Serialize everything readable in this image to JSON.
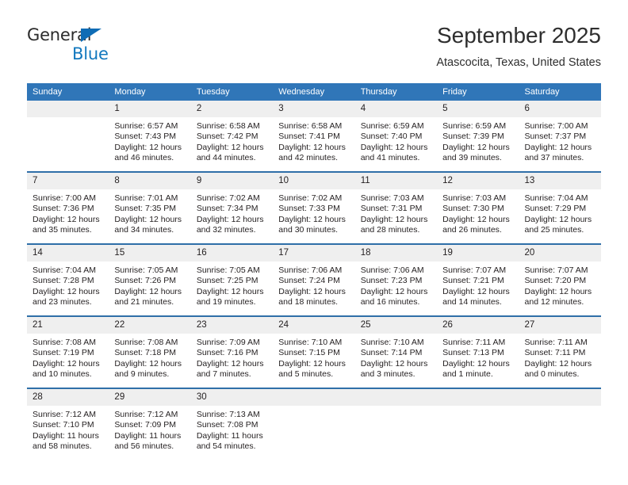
{
  "brand": {
    "line1": "General",
    "line2": "Blue",
    "triangle_color": "#0f6cb5",
    "text_color": "#2b2b2b",
    "blue_color": "#1278be"
  },
  "header": {
    "title": "September 2025",
    "subtitle": "Atascocita, Texas, United States"
  },
  "theme": {
    "header_bg": "#3076b8",
    "row_divider": "#2f6fa8",
    "daynum_bg": "#efefef",
    "text": "#231f20"
  },
  "calendar": {
    "weekday_headers": [
      "Sunday",
      "Monday",
      "Tuesday",
      "Wednesday",
      "Thursday",
      "Friday",
      "Saturday"
    ],
    "weeks": [
      [
        {
          "day": "",
          "empty": true,
          "sunrise": "",
          "sunset": "",
          "daylight1": "",
          "daylight2": ""
        },
        {
          "day": "1",
          "sunrise": "Sunrise: 6:57 AM",
          "sunset": "Sunset: 7:43 PM",
          "daylight1": "Daylight: 12 hours",
          "daylight2": "and 46 minutes."
        },
        {
          "day": "2",
          "sunrise": "Sunrise: 6:58 AM",
          "sunset": "Sunset: 7:42 PM",
          "daylight1": "Daylight: 12 hours",
          "daylight2": "and 44 minutes."
        },
        {
          "day": "3",
          "sunrise": "Sunrise: 6:58 AM",
          "sunset": "Sunset: 7:41 PM",
          "daylight1": "Daylight: 12 hours",
          "daylight2": "and 42 minutes."
        },
        {
          "day": "4",
          "sunrise": "Sunrise: 6:59 AM",
          "sunset": "Sunset: 7:40 PM",
          "daylight1": "Daylight: 12 hours",
          "daylight2": "and 41 minutes."
        },
        {
          "day": "5",
          "sunrise": "Sunrise: 6:59 AM",
          "sunset": "Sunset: 7:39 PM",
          "daylight1": "Daylight: 12 hours",
          "daylight2": "and 39 minutes."
        },
        {
          "day": "6",
          "sunrise": "Sunrise: 7:00 AM",
          "sunset": "Sunset: 7:37 PM",
          "daylight1": "Daylight: 12 hours",
          "daylight2": "and 37 minutes."
        }
      ],
      [
        {
          "day": "7",
          "sunrise": "Sunrise: 7:00 AM",
          "sunset": "Sunset: 7:36 PM",
          "daylight1": "Daylight: 12 hours",
          "daylight2": "and 35 minutes."
        },
        {
          "day": "8",
          "sunrise": "Sunrise: 7:01 AM",
          "sunset": "Sunset: 7:35 PM",
          "daylight1": "Daylight: 12 hours",
          "daylight2": "and 34 minutes."
        },
        {
          "day": "9",
          "sunrise": "Sunrise: 7:02 AM",
          "sunset": "Sunset: 7:34 PM",
          "daylight1": "Daylight: 12 hours",
          "daylight2": "and 32 minutes."
        },
        {
          "day": "10",
          "sunrise": "Sunrise: 7:02 AM",
          "sunset": "Sunset: 7:33 PM",
          "daylight1": "Daylight: 12 hours",
          "daylight2": "and 30 minutes."
        },
        {
          "day": "11",
          "sunrise": "Sunrise: 7:03 AM",
          "sunset": "Sunset: 7:31 PM",
          "daylight1": "Daylight: 12 hours",
          "daylight2": "and 28 minutes."
        },
        {
          "day": "12",
          "sunrise": "Sunrise: 7:03 AM",
          "sunset": "Sunset: 7:30 PM",
          "daylight1": "Daylight: 12 hours",
          "daylight2": "and 26 minutes."
        },
        {
          "day": "13",
          "sunrise": "Sunrise: 7:04 AM",
          "sunset": "Sunset: 7:29 PM",
          "daylight1": "Daylight: 12 hours",
          "daylight2": "and 25 minutes."
        }
      ],
      [
        {
          "day": "14",
          "sunrise": "Sunrise: 7:04 AM",
          "sunset": "Sunset: 7:28 PM",
          "daylight1": "Daylight: 12 hours",
          "daylight2": "and 23 minutes."
        },
        {
          "day": "15",
          "sunrise": "Sunrise: 7:05 AM",
          "sunset": "Sunset: 7:26 PM",
          "daylight1": "Daylight: 12 hours",
          "daylight2": "and 21 minutes."
        },
        {
          "day": "16",
          "sunrise": "Sunrise: 7:05 AM",
          "sunset": "Sunset: 7:25 PM",
          "daylight1": "Daylight: 12 hours",
          "daylight2": "and 19 minutes."
        },
        {
          "day": "17",
          "sunrise": "Sunrise: 7:06 AM",
          "sunset": "Sunset: 7:24 PM",
          "daylight1": "Daylight: 12 hours",
          "daylight2": "and 18 minutes."
        },
        {
          "day": "18",
          "sunrise": "Sunrise: 7:06 AM",
          "sunset": "Sunset: 7:23 PM",
          "daylight1": "Daylight: 12 hours",
          "daylight2": "and 16 minutes."
        },
        {
          "day": "19",
          "sunrise": "Sunrise: 7:07 AM",
          "sunset": "Sunset: 7:21 PM",
          "daylight1": "Daylight: 12 hours",
          "daylight2": "and 14 minutes."
        },
        {
          "day": "20",
          "sunrise": "Sunrise: 7:07 AM",
          "sunset": "Sunset: 7:20 PM",
          "daylight1": "Daylight: 12 hours",
          "daylight2": "and 12 minutes."
        }
      ],
      [
        {
          "day": "21",
          "sunrise": "Sunrise: 7:08 AM",
          "sunset": "Sunset: 7:19 PM",
          "daylight1": "Daylight: 12 hours",
          "daylight2": "and 10 minutes."
        },
        {
          "day": "22",
          "sunrise": "Sunrise: 7:08 AM",
          "sunset": "Sunset: 7:18 PM",
          "daylight1": "Daylight: 12 hours",
          "daylight2": "and 9 minutes."
        },
        {
          "day": "23",
          "sunrise": "Sunrise: 7:09 AM",
          "sunset": "Sunset: 7:16 PM",
          "daylight1": "Daylight: 12 hours",
          "daylight2": "and 7 minutes."
        },
        {
          "day": "24",
          "sunrise": "Sunrise: 7:10 AM",
          "sunset": "Sunset: 7:15 PM",
          "daylight1": "Daylight: 12 hours",
          "daylight2": "and 5 minutes."
        },
        {
          "day": "25",
          "sunrise": "Sunrise: 7:10 AM",
          "sunset": "Sunset: 7:14 PM",
          "daylight1": "Daylight: 12 hours",
          "daylight2": "and 3 minutes."
        },
        {
          "day": "26",
          "sunrise": "Sunrise: 7:11 AM",
          "sunset": "Sunset: 7:13 PM",
          "daylight1": "Daylight: 12 hours",
          "daylight2": "and 1 minute."
        },
        {
          "day": "27",
          "sunrise": "Sunrise: 7:11 AM",
          "sunset": "Sunset: 7:11 PM",
          "daylight1": "Daylight: 12 hours",
          "daylight2": "and 0 minutes."
        }
      ],
      [
        {
          "day": "28",
          "sunrise": "Sunrise: 7:12 AM",
          "sunset": "Sunset: 7:10 PM",
          "daylight1": "Daylight: 11 hours",
          "daylight2": "and 58 minutes."
        },
        {
          "day": "29",
          "sunrise": "Sunrise: 7:12 AM",
          "sunset": "Sunset: 7:09 PM",
          "daylight1": "Daylight: 11 hours",
          "daylight2": "and 56 minutes."
        },
        {
          "day": "30",
          "sunrise": "Sunrise: 7:13 AM",
          "sunset": "Sunset: 7:08 PM",
          "daylight1": "Daylight: 11 hours",
          "daylight2": "and 54 minutes."
        },
        {
          "day": "",
          "empty": true,
          "sunrise": "",
          "sunset": "",
          "daylight1": "",
          "daylight2": ""
        },
        {
          "day": "",
          "empty": true,
          "sunrise": "",
          "sunset": "",
          "daylight1": "",
          "daylight2": ""
        },
        {
          "day": "",
          "empty": true,
          "sunrise": "",
          "sunset": "",
          "daylight1": "",
          "daylight2": ""
        },
        {
          "day": "",
          "empty": true,
          "sunrise": "",
          "sunset": "",
          "daylight1": "",
          "daylight2": ""
        }
      ]
    ]
  }
}
